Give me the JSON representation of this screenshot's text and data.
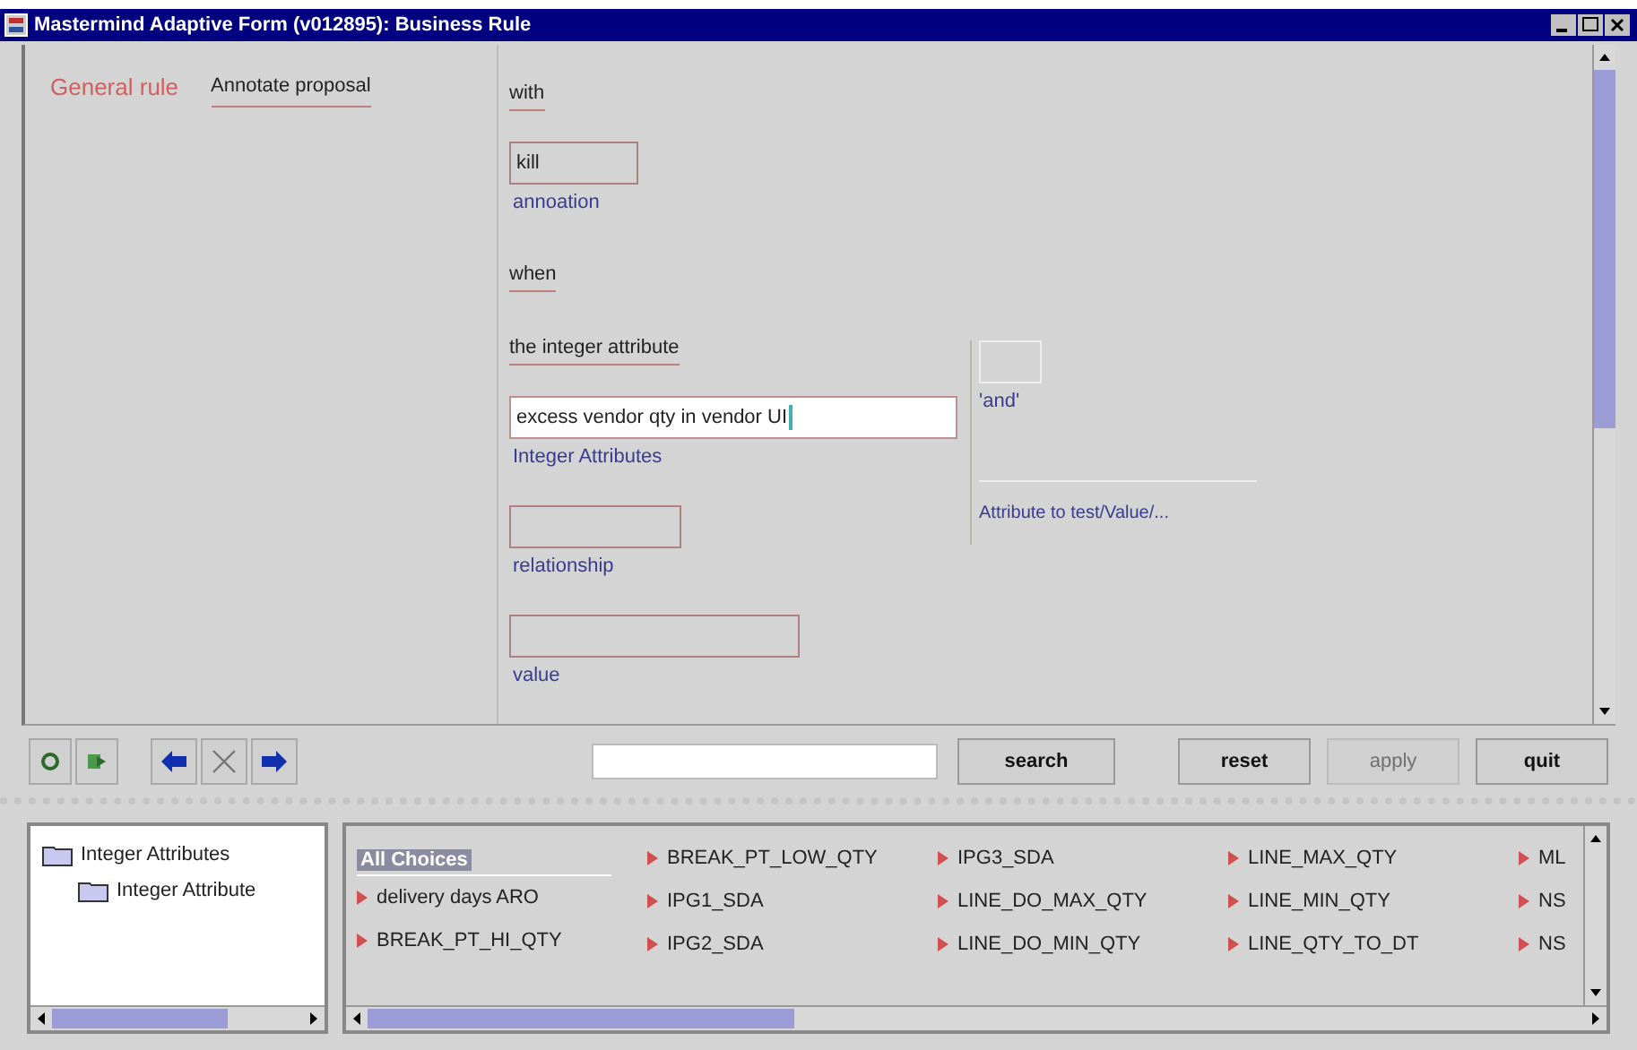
{
  "window": {
    "title": "Mastermind Adaptive Form (v012895): Business Rule"
  },
  "rule": {
    "type": "General rule",
    "action": "Annotate proposal"
  },
  "form": [
    {
      "kind": "heading",
      "text": "with"
    },
    {
      "kind": "field",
      "value": "kill",
      "caption": "annoation"
    },
    {
      "kind": "heading",
      "text": "when"
    },
    {
      "kind": "heading",
      "text": "the integer attribute"
    },
    {
      "kind": "input",
      "value": "excess vendor qty in vendor UI",
      "caption": "Integer Attributes",
      "focused": true
    },
    {
      "kind": "field",
      "caption": "relationship"
    },
    {
      "kind": "field",
      "caption": "value"
    }
  ],
  "side": {
    "connector_caption": "'and'",
    "hint": "Attribute to test/Value/..."
  },
  "toolbar": {
    "search_button": "search",
    "buttons": [
      {
        "label": "reset",
        "disabled": false
      },
      {
        "label": "apply",
        "disabled": true
      },
      {
        "label": "quit",
        "disabled": false
      }
    ]
  },
  "tree": [
    {
      "label": "Integer Attributes",
      "children": [
        {
          "label": "Integer Attribute"
        }
      ]
    }
  ],
  "choices": {
    "header": "All Choices",
    "columns": [
      [
        "delivery days ARO",
        "BREAK_PT_HI_QTY"
      ],
      [
        "BREAK_PT_LOW_QTY",
        "IPG1_SDA",
        "IPG2_SDA"
      ],
      [
        "IPG3_SDA",
        "LINE_DO_MAX_QTY",
        "LINE_DO_MIN_QTY"
      ],
      [
        "LINE_MAX_QTY",
        "LINE_MIN_QTY",
        "LINE_QTY_TO_DT"
      ],
      [
        "ML",
        "NS",
        "NS"
      ]
    ]
  }
}
